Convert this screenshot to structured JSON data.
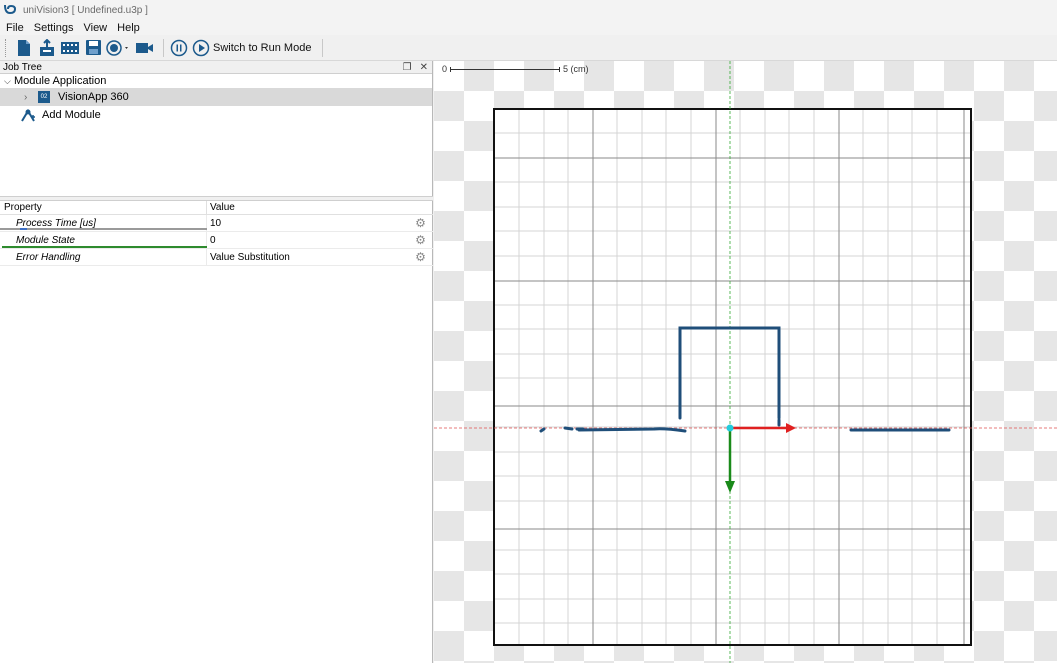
{
  "window": {
    "title": "uniVision3 [ Undefined.u3p ]"
  },
  "menu": {
    "items": [
      "File",
      "Settings",
      "View",
      "Help"
    ]
  },
  "toolbar": {
    "run_mode_label": "Switch to Run Mode",
    "icons": [
      "new-file-icon",
      "import-icon",
      "filmstrip-icon",
      "save-icon",
      "record-icon",
      "camera-icon",
      "pause-icon",
      "play-icon"
    ]
  },
  "job_tree": {
    "header": "Job Tree",
    "root_label": "Module Application",
    "app_label": "VisionApp 360",
    "app_badge": "02",
    "add_module_label": "Add Module"
  },
  "properties": {
    "col_property": "Property",
    "col_value": "Value",
    "rows": [
      {
        "name": "Process Time [us]",
        "value": "10"
      },
      {
        "name": "Module State",
        "value": "0"
      },
      {
        "name": "Error Handling",
        "value": "Value Substitution"
      }
    ]
  },
  "canvas": {
    "scale_start": "0",
    "scale_end": "5",
    "scale_unit": "(cm)"
  },
  "colors": {
    "profile": "#1f4e79",
    "x_axis_arrow": "#e02020",
    "y_axis_arrow": "#1a8a1a",
    "origin": "#22ccdd",
    "guide_red": "#e05050",
    "guide_green": "#33aa33",
    "selection": "#d9d9d9"
  }
}
